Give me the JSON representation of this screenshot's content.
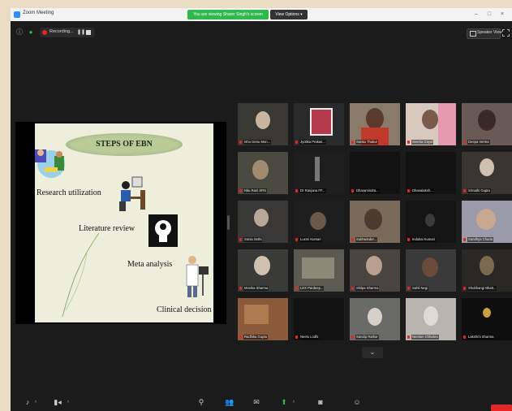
{
  "window": {
    "title": "Zoom Meeting"
  },
  "share_banner": {
    "label": "You are viewing Sharer Singh's screen"
  },
  "view_options": {
    "label": "View Options ▾"
  },
  "recording": {
    "label": "Recording..."
  },
  "speaker_view": {
    "label": "Speaker View"
  },
  "slide": {
    "title": "STEPS OF EBN",
    "items": [
      "Research utilization",
      "Literature review",
      "Meta analysis",
      "Clinical decision"
    ]
  },
  "participants": [
    {
      "name": "Ishu Genu Mon..."
    },
    {
      "name": "Jyotika Prakas..."
    },
    {
      "name": "Sunita Thakur"
    },
    {
      "name": "Seema Goyal"
    },
    {
      "name": "Deepa Verma"
    },
    {
      "name": "Nitu Rani SRS"
    },
    {
      "name": "Dr Ranjana FF..."
    },
    {
      "name": "Dharamindra..."
    },
    {
      "name": "Dhanalaksh..."
    },
    {
      "name": "Srinathi Gupta"
    },
    {
      "name": "Sonia Sethi"
    },
    {
      "name": "Luxmi Kumari"
    },
    {
      "name": "Sukhwinder..."
    },
    {
      "name": "Indukai Kumari"
    },
    {
      "name": "Sandhya Chada"
    },
    {
      "name": "Monika Sharma"
    },
    {
      "name": "LEX Pardeep..."
    },
    {
      "name": "Shilpa Sharma"
    },
    {
      "name": "Sahil Negi"
    },
    {
      "name": "Shubhangi Bhatt..."
    },
    {
      "name": "Radhika Gupta"
    },
    {
      "name": "Neelu Lodhi"
    },
    {
      "name": "Sandip Rathor"
    },
    {
      "name": "Neelam Chhabra"
    },
    {
      "name": "Lakshmi Sharma"
    }
  ],
  "page_down": {
    "label": "⌄"
  },
  "colors": {
    "recording": "#e02828",
    "share_banner": "#2fb84c",
    "active_speaker": "#c9c04a"
  }
}
